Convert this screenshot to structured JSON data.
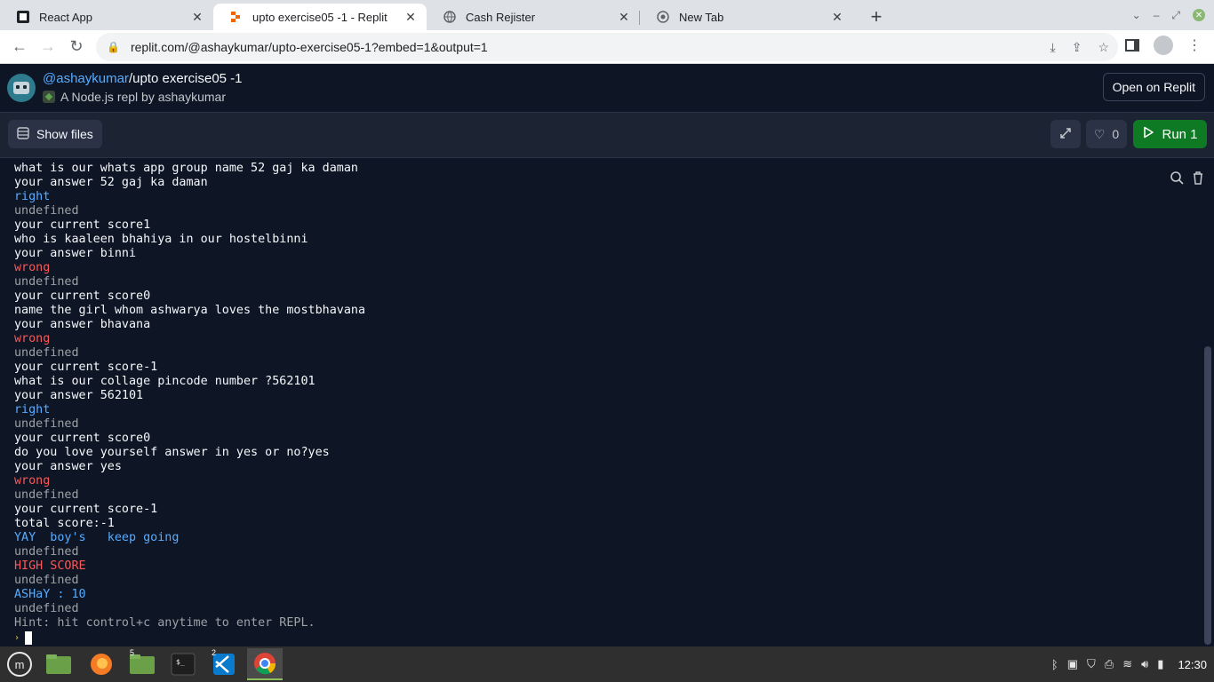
{
  "browser": {
    "tabs": [
      {
        "title": "React App",
        "icon": "react-app-icon"
      },
      {
        "title": "upto exercise05 -1 - Replit",
        "icon": "replit-icon"
      },
      {
        "title": "Cash Rejister",
        "icon": "globe-icon"
      },
      {
        "title": "New Tab",
        "icon": "chrome-icon"
      }
    ],
    "url": "replit.com/@ashaykumar/upto-exercise05-1?embed=1&output=1"
  },
  "repl": {
    "user": "@ashaykumar",
    "separator": "/",
    "name": "upto exercise05 -1",
    "subtitle": "A Node.js repl by ashaykumar",
    "open_label": "Open on Replit",
    "show_files_label": "Show files",
    "likes": "0",
    "run_label": "Run 1"
  },
  "console": {
    "lines": [
      {
        "text": "what is our whats app group name 52 gaj ka daman",
        "kind": "normal"
      },
      {
        "text": "your answer 52 gaj ka daman",
        "kind": "normal"
      },
      {
        "text": "right",
        "kind": "right"
      },
      {
        "text": "undefined",
        "kind": "undef"
      },
      {
        "text": "your current score1",
        "kind": "normal"
      },
      {
        "text": "who is kaaleen bhahiya in our hostelbinni",
        "kind": "normal"
      },
      {
        "text": "your answer binni",
        "kind": "normal"
      },
      {
        "text": "wrong",
        "kind": "wrong"
      },
      {
        "text": "undefined",
        "kind": "undef"
      },
      {
        "text": "your current score0",
        "kind": "normal"
      },
      {
        "text": "name the girl whom ashwarya loves the mostbhavana",
        "kind": "normal"
      },
      {
        "text": "your answer bhavana",
        "kind": "normal"
      },
      {
        "text": "wrong",
        "kind": "wrong"
      },
      {
        "text": "undefined",
        "kind": "undef"
      },
      {
        "text": "your current score-1",
        "kind": "normal"
      },
      {
        "text": "what is our collage pincode number ?562101",
        "kind": "normal"
      },
      {
        "text": "your answer 562101",
        "kind": "normal"
      },
      {
        "text": "right",
        "kind": "right"
      },
      {
        "text": "undefined",
        "kind": "undef"
      },
      {
        "text": "your current score0",
        "kind": "normal"
      },
      {
        "text": "do you love yourself answer in yes or no?yes",
        "kind": "normal"
      },
      {
        "text": "your answer yes",
        "kind": "normal"
      },
      {
        "text": "wrong",
        "kind": "wrong"
      },
      {
        "text": "undefined",
        "kind": "undef"
      },
      {
        "text": "your current score-1",
        "kind": "normal"
      },
      {
        "text": "total score:-1",
        "kind": "normal"
      },
      {
        "text": "YAY  boy's   keep going",
        "kind": "blue"
      },
      {
        "text": "undefined",
        "kind": "undef"
      },
      {
        "text": "HIGH SCORE",
        "kind": "red"
      },
      {
        "text": "undefined",
        "kind": "undef"
      },
      {
        "text": "ASHaY : 10",
        "kind": "blue"
      },
      {
        "text": "undefined",
        "kind": "undef"
      },
      {
        "text": "Hint: hit control+c anytime to enter REPL.",
        "kind": "hint"
      }
    ]
  },
  "taskbar": {
    "apps": [
      {
        "name": "mint-menu-icon",
        "badge": ""
      },
      {
        "name": "files-icon",
        "badge": ""
      },
      {
        "name": "firefox-icon",
        "badge": ""
      },
      {
        "name": "folder-icon",
        "badge": "5"
      },
      {
        "name": "terminal-icon",
        "badge": ""
      },
      {
        "name": "vscode-icon",
        "badge": "2"
      },
      {
        "name": "chrome-icon",
        "badge": ""
      }
    ],
    "clock": "12:30"
  },
  "colors": {
    "replit_bg": "#0e1525",
    "run_green": "#0f7a24",
    "link_blue": "#57abff",
    "error_red": "#f75959"
  }
}
